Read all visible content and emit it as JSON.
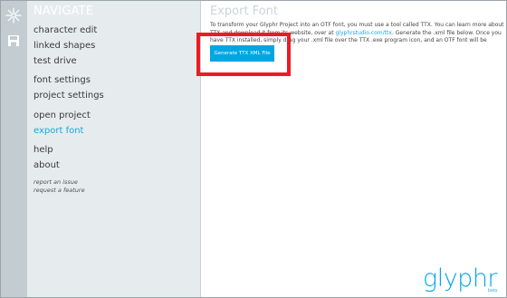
{
  "nav": {
    "title": "NAVIGATE",
    "groups": [
      [
        "character edit",
        "linked shapes",
        "test drive"
      ],
      [
        "font settings",
        "project settings"
      ],
      [
        "open project",
        "export font"
      ],
      [
        "help",
        "about"
      ]
    ],
    "active": "export font",
    "small_links": [
      "report an issue",
      "request a feature"
    ]
  },
  "rail": {
    "icons": [
      "glyphr-star-icon",
      "save-icon"
    ]
  },
  "content": {
    "title": "Export Font",
    "description_before_link": "To transform your Glyphr Project into an OTF font, you must use a tool called TTX. You can learn more about TTX and download it from its website, over at ",
    "link_text": "glyphrstudio.com/ttx",
    "description_after_link": ". Generate the .xml file below. Once you have TTX installed, simply drag your .xml file over the TTX .exe program icon, and an OTF font will be generated.",
    "button_label": "Generate TTX XML File"
  },
  "brand": {
    "logo_text": "glyphr",
    "logo_subtext": "beta"
  },
  "colors": {
    "accent": "#00a6e4",
    "highlight": "#ec1b24",
    "nav_bg": "#e6ecee",
    "rail_bg": "#c3cdd1"
  }
}
